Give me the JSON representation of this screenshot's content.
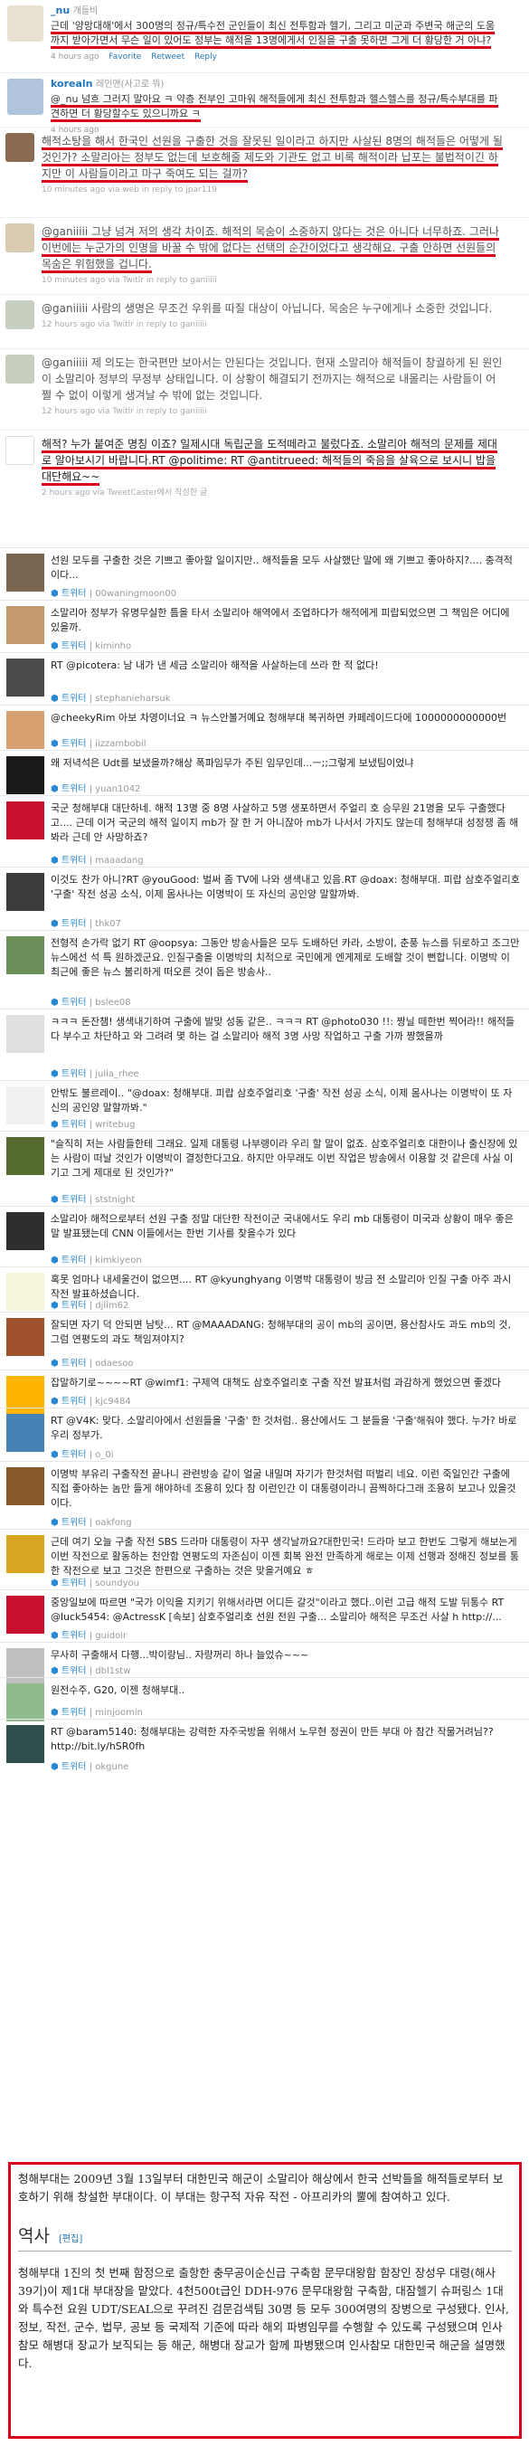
{
  "tweets_top": [
    {
      "user": "_nu",
      "realname": "개들비",
      "text": "근데 '양망대해'에서 300명의 정규/특수전 군인들이 최신 전투함과 헬기, 그리고 미군과 주변국 해군의 도움까지 받아가면서 무슨 일이 있어도 정부는 해적을 13명에게서 인질을 구출 못하면 그게 더 황당한 거 아냐?",
      "meta": "4 hours ago",
      "actions": [
        "Favorite",
        "Retweet",
        "Reply"
      ]
    },
    {
      "user": "korealn",
      "realname": "레인맨(사고로 뭐)",
      "text": "@_nu 넘흐 그러지 말아요 ㅋ 약층 전부인 고마워 해적들에게 최신 전투함과 헬스헬스를 정규/특수부대를 파견하면 더 황당할수도 있으니까요 ㅋ",
      "meta": "4 hours ago"
    }
  ],
  "tweets_mid": [
    {
      "text": "해적소탕을 해서 한국인 선원을 구출한 것을 잘못된 일이라고 하지만 사살된 8명의 해적들은 어떻게 될 것인가? 소말리아는 정부도 없는데 보호해줄 제도와 기관도 없고 비록 해적이라 납포는 불법적이긴 하지만 이 사람들이라고 마구 죽여도 되는 걸까?",
      "meta": "10 minutes ago via web in reply to jpar119"
    },
    {
      "text": "@ganiiiii 그냥 넘겨 저의 생각 차이죠. 해적의 목숨이 소중하지 않다는 것은 아니다 너무하죠. 그러나 이번에는 누군가의 인명을 바꿀 수 밖에 없다는 선택의 순간이었다고 생각해요. 구출 안하면 선원들의 목숨은 위험했을 겁니다.",
      "meta": "10 minutes ago via Twitlr in reply to ganiiiii"
    },
    {
      "text": "@ganiiiii 사람의 생명은 무조건 우위를 따질 대상이 아닙니다. 목숨은 누구에게나 소중한 것입니다.",
      "meta": "12 hours ago via Twitlr in reply to ganiiiii"
    },
    {
      "text": "@ganiiiii 제 의도는 한국편만 보아서는 안된다는 것입니다. 현재 소말리아 해적들이 창궐하게 된 원인이 소말리아 정부의 무정부 상태입니다. 이 상황이 해결되기 전까지는 해적으로 내몰리는 사람들이 어쩔 수 없이 이렇게 생겨날 수 밖에 없는 것입니다.",
      "meta": "12 hours ago via Twitlr in reply to ganiiiii"
    },
    {
      "text": "해적? 누가 붙여준 명칭 이죠? 일제시대 독립군을 도적떼라고 불렀다죠. 소말리아 해적의 문제를 제대로 알아보시기 바랍니다.RT @politime: RT @antitrueed: 해적들의 죽음을 살육으로 보시니 밥을 대단해요~~",
      "meta": "2 hours ago via TweetCaster에서 작성한 글"
    }
  ],
  "list": [
    {
      "text": "선원 모두를 구출한 것은 기쁘고 좋아할 일이지만.. 해적들을 모두 사살했단 말에 왜 기쁘고 좋아하지?.... 충격적이다...",
      "meta": "00waningmoon00"
    },
    {
      "text": "소말리아 정부가 유명무실한 틈을 타서 소말리아 해역에서 조업하다가 해적에게 피랍되었으면 그 책임은 어디에 있을까.",
      "meta": "kiminho"
    },
    {
      "text": "RT @picotera: 남 내가 낸 세금 소말리아 해적을 사살하는데 쓰라 한 적 없다!",
      "meta": "stephanieharsuk"
    },
    {
      "text": "@cheekyRim 아보 차영이너요 ㅋ 뉴스안볼거예요 청해부대 복귀하면 카페레이드다에 1000000000000번",
      "meta": "iizzambobil"
    },
    {
      "text": "왜 저녁석은 Udt를 보냈을까?해상 폭파임무가 주된 임무인데...ㅡ;;그렇게 보냈팀이었냐",
      "meta": "yuan1042"
    },
    {
      "text": "국군 청해부대 대단하네. 해적 13명 중 8명 사살하고 5명 생포하면서 주얼리 호 승무원 21명을 모두 구출했다고.... 근데 이거 국군의 해적 일이지 mb가 잘 한 거 아니잖아 mb가 나서서 가지도 않는데 청해부대 성정쟁 좀 해봐라 근데 안 사망하죠?",
      "meta": "maaadang"
    },
    {
      "text": "이것도 찬가 아니?RT @youGood: 벌써 좀 TV에 나와 생색내고 있음.RT @doax: 청해부대. 피랍 삼호주얼리호 '구출' 작전 성공 소식, 이제 몸사나는 이명박이 또 자신의 공인양 말할까봐.",
      "meta": "thk07"
    },
    {
      "text": "전형적 손가락 없기 RT @oopsya: 그동안 방송사들은 모두 도배하던 카라, 소방이, 춘풍 뉴스를 뒤로하고 조그만 뉴스에선 석 특 원하겠군요. 인질구출을 이명박의 치적으로 국민에게 엔게제로 도배할 것이 뻔합니다. 이명박 이 최근에 좋은 뉴스 불리하게 떠오른 것이 돕은 방송사..",
      "meta": "bslee08"
    },
    {
      "text": "ㅋㅋㅋ 돈잔챔! 생색내기하여 구출에 발맞 성동 같은.. ㅋㅋㅋ RT @photo030 !!: 짱닐 떼한번 찍어라!! 해적들 다 부수고 차단하고 와 그려려 몇 하는 걸 소말리아 해적 3명 사망 작업하고 구출 가까 짱했을까",
      "meta": "julia_rhee"
    },
    {
      "text": "안밖도 불르레이.. \"@doax: 청해부대. 피랍 삼호주얼리호 '구출' 작전 성공 소식, 이제 몸사나는 이명박이 또 자신의 공인양 말할까봐.\"",
      "meta": "writebug"
    },
    {
      "text": "\"슬직히 저는 사람들한테 그래요. 일제 대통령 나부랭이라 우리 할 말이 없죠. 삼호주얼리호 대한이나 출신장에 있는 사람이 떠날 것인가 이명박이 결정한다고요. 하지만 아무래도 이번 작업은 방송에서 이용할 것 같은데 사실 이기고 그게 제대로 된 것인가?\"",
      "meta": "ststnight"
    },
    {
      "text": "소말리아 해적으로부터 선원 구출 정말 대단한 작전이군 국내에서도 우리 mb 대통령이 미국과 상황이 매우 좋은 말 발표됐는데 CNN 이들에서는 한번 기사를 찾을수가 있다",
      "meta": "kimkiyeon"
    },
    {
      "text": "혹못 엄마나 내세울건이 없으면.... RT @kyunghyang 이명박 대통령이 방금 전 소말리아 인질 구출 아주 과시 작전 발표하셨습니다.",
      "meta": "djlim62"
    },
    {
      "text": "잘되면 자기 덕 안되면 남탓... RT @MAAADANG: 청해부대의 공이 mb의 공이면, 용산참사도 과도 mb의 것, 그럼 연평도의 과도 책임져야지?",
      "meta": "odaesoo"
    },
    {
      "text": "잡말하기로~~~~RT @wimf1: 구제역 대책도 삼호주얼리호 구출 작전 발표처럼 과감하게 했었으면 좋겠다",
      "meta": "kjc9484"
    },
    {
      "text": "RT @V4K: 맞다. 소말리아에서 선원들을 '구출' 한 것처럼.. 용산에서도 그 분들을 '구출'해줘야 했다. 누가? 바로 우리 정부가.",
      "meta": "o_0i"
    },
    {
      "text": "이명박 부유리 구출작전 끝나니 관련방송 같이 얼굴 내밀며 자기가 한것처럼 떠벌리 네요. 이런 죽일인간 구출에 직접 좋아하는 놈만 들게 해야하네 조용히 있다 참 이런인간 이 대통령이라니 끔찍하다그래 조용히 보고나 있을것이다.",
      "meta": "oakfong"
    },
    {
      "text": "근데 여기 오늘 구출 작전 SBS 드라마 대통령이 자꾸 생각날까요?대한민국! 드라마 보고 한번도 그렇게 해보는게 이번 작전으로 활동하는 천안함 연평도의 자존심이 이젠 회복 완전 만족하게 해로는 이제 선행과 정해진 정보를 통한 작전으로 보고 그것은 한편으로 구출하는 것은 맞을거예요 ㅎ",
      "meta": "soundyou"
    },
    {
      "text": "중앙일보에 따르면 \"국가 이익을 지키기 위해서라면 어디든 갈것\"이라고 했다..이런 고급 해적 도발 뒤통수 RT @luck5454: @ActressK [속보] 삼호주얼리호 선원 전원 구출... 소말리아 해적은 무조건 사살 h http://...",
      "meta": "guidoir"
    },
    {
      "text": "무사히 구출해서 다행...박이랑님.. 자랑꺼리 하나 늘었슈~~~",
      "meta": "dbl1stw"
    },
    {
      "text": "원전수주, G20, 이젠 청해부대..",
      "meta": "minjoomin"
    },
    {
      "text": "RT @baram5140: 청해부대는 강력한 자주국방을 위해서 노무현 정권이 만든 부대 아 참간 작물거려님?? http://bit.ly/hSR0fh",
      "meta": "okgune"
    }
  ],
  "wiki": {
    "lead": "청해부대는 2009년 3월 13일부터 대한민국 해군이 소말리아 해상에서 한국 선박들을 해적들로부터 보호하기 위해 창설한 부대이다. 이 부대는 항구적 자유 작전 - 아프리카의 뿔에 참여하고 있다.",
    "heading": "역사",
    "edit": "[편집]",
    "history": "청해부대 1진의 첫 번째 함정으로 출항한 충무공이순신급 구축함 문무대왕함 함장인 장성우 대령(해사 39기)이 제1대 부대장을 맡았다. 4천500t급인 DDH-976 문무대왕함 구축함, 대잠헬기 슈퍼링스 1대와 특수전 요원 UDT/SEAL으로 꾸려진 검문검색팀 30명 등 모두 300여명의 장병으로 구성됐다. 인사, 정보, 작전, 군수, 법무, 공보 등 국제적 기준에 따라 해외 파병임무를 수행할 수 있도록 구성됐으며 인사참모 해병대 장교가 보직되는 등 해군, 해병대 장교가 함께 파병됐으며 인사참모 대한민국 해군을 설명했다."
  },
  "labels": {
    "retweeter": "트위터"
  },
  "colors": {
    "highlight": "#d8001c",
    "link": "#2276bb",
    "wiki_link": "#0645ad"
  }
}
